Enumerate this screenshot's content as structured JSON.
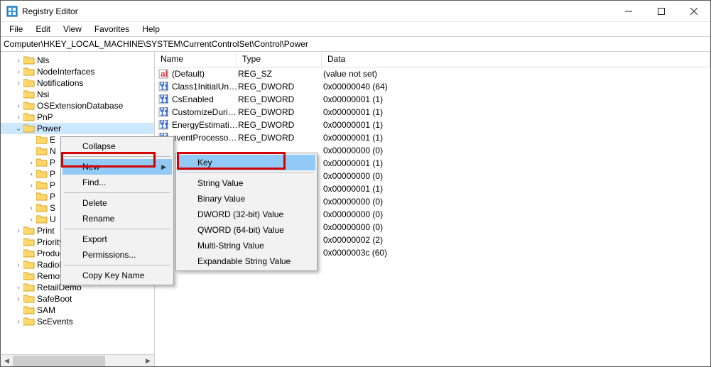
{
  "window": {
    "title": "Registry Editor"
  },
  "menu": {
    "file": "File",
    "edit": "Edit",
    "view": "View",
    "favorites": "Favorites",
    "help": "Help"
  },
  "address": "Computer\\HKEY_LOCAL_MACHINE\\SYSTEM\\CurrentControlSet\\Control\\Power",
  "tree": {
    "items": [
      {
        "label": "Nls",
        "indent": 1,
        "exp": ">"
      },
      {
        "label": "NodeInterfaces",
        "indent": 1,
        "exp": ">"
      },
      {
        "label": "Notifications",
        "indent": 1,
        "exp": ">"
      },
      {
        "label": "Nsi",
        "indent": 1,
        "exp": ""
      },
      {
        "label": "OSExtensionDatabase",
        "indent": 1,
        "exp": ">"
      },
      {
        "label": "PnP",
        "indent": 1,
        "exp": ">"
      },
      {
        "label": "Power",
        "indent": 1,
        "exp": "v",
        "selected": true
      },
      {
        "label": "E",
        "indent": 2,
        "exp": ""
      },
      {
        "label": "N",
        "indent": 2,
        "exp": ""
      },
      {
        "label": "P",
        "indent": 2,
        "exp": ">"
      },
      {
        "label": "P",
        "indent": 2,
        "exp": ">"
      },
      {
        "label": "P",
        "indent": 2,
        "exp": ">"
      },
      {
        "label": "P",
        "indent": 2,
        "exp": ""
      },
      {
        "label": "S",
        "indent": 2,
        "exp": ">"
      },
      {
        "label": "U",
        "indent": 2,
        "exp": ">"
      },
      {
        "label": "Print",
        "indent": 1,
        "exp": ">"
      },
      {
        "label": "PriorityControl",
        "indent": 1,
        "exp": ""
      },
      {
        "label": "ProductOptions",
        "indent": 1,
        "exp": ""
      },
      {
        "label": "RadioManagement",
        "indent": 1,
        "exp": ">"
      },
      {
        "label": "Remote Assistance",
        "indent": 1,
        "exp": ""
      },
      {
        "label": "RetailDemo",
        "indent": 1,
        "exp": ">"
      },
      {
        "label": "SafeBoot",
        "indent": 1,
        "exp": ">"
      },
      {
        "label": "SAM",
        "indent": 1,
        "exp": ""
      },
      {
        "label": "ScEvents",
        "indent": 1,
        "exp": ">"
      }
    ]
  },
  "list": {
    "headers": {
      "name": "Name",
      "type": "Type",
      "data": "Data"
    },
    "rows": [
      {
        "icon": "string",
        "name": "(Default)",
        "type": "REG_SZ",
        "data": "(value not set)"
      },
      {
        "icon": "binary",
        "name": "Class1InitialUnp...",
        "type": "REG_DWORD",
        "data": "0x00000040 (64)"
      },
      {
        "icon": "binary",
        "name": "CsEnabled",
        "type": "REG_DWORD",
        "data": "0x00000001 (1)"
      },
      {
        "icon": "binary",
        "name": "CustomizeDurin...",
        "type": "REG_DWORD",
        "data": "0x00000001 (1)"
      },
      {
        "icon": "binary",
        "name": "EnergyEstimatio...",
        "type": "REG_DWORD",
        "data": "0x00000001 (1)"
      },
      {
        "icon": "binary",
        "name": "eventProcessorE...",
        "type": "REG_DWORD",
        "data": "0x00000001 (1)"
      },
      {
        "icon": "binary",
        "name": "",
        "type": "",
        "data": "0x00000000 (0)"
      },
      {
        "icon": "binary",
        "name": "",
        "type": "",
        "data": "0x00000001 (1)"
      },
      {
        "icon": "binary",
        "name": "",
        "type": "",
        "data": "0x00000000 (0)"
      },
      {
        "icon": "binary",
        "name": "",
        "type": "",
        "data": "0x00000001 (1)"
      },
      {
        "icon": "binary",
        "name": "",
        "type": "",
        "data": "0x00000000 (0)"
      },
      {
        "icon": "binary",
        "name": "",
        "type": "",
        "data": "0x00000000 (0)"
      },
      {
        "icon": "binary",
        "name": "",
        "type": "",
        "data": "0x00000000 (0)"
      },
      {
        "icon": "binary",
        "name": "",
        "type": "",
        "data": "0x00000002 (2)"
      },
      {
        "icon": "binary",
        "name": "",
        "type": "",
        "data": "0x0000003c (60)"
      }
    ]
  },
  "context_menu": {
    "collapse": "Collapse",
    "new": "New",
    "find": "Find...",
    "delete": "Delete",
    "rename": "Rename",
    "export": "Export",
    "permissions": "Permissions...",
    "copy_key_name": "Copy Key Name"
  },
  "submenu": {
    "key": "Key",
    "string_value": "String Value",
    "binary_value": "Binary Value",
    "dword": "DWORD (32-bit) Value",
    "qword": "QWORD (64-bit) Value",
    "multi_string": "Multi-String Value",
    "exp_string": "Expandable String Value"
  }
}
